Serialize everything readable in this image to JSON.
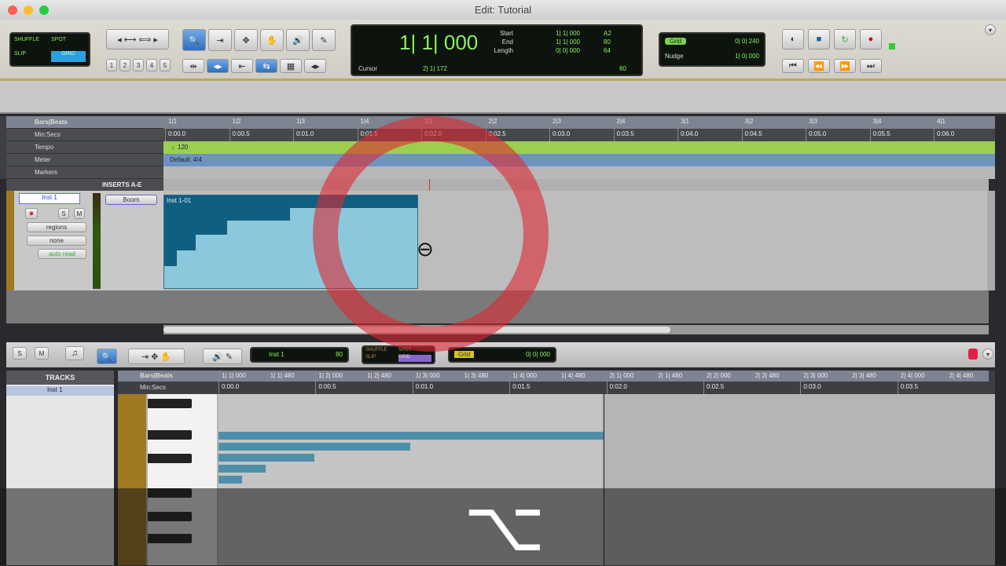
{
  "window": {
    "title": "Edit: Tutorial"
  },
  "toolbar": {
    "edit_modes": [
      "SHUFFLE",
      "SPOT",
      "SLIP",
      "GRID"
    ],
    "zoom_presets": [
      "1",
      "2",
      "3",
      "4",
      "5"
    ],
    "main_counter": "1| 1| 000",
    "start_label": "Start",
    "end_label": "End",
    "length_label": "Length",
    "start": "1| 1| 000",
    "end": "1| 1| 000",
    "length": "0| 0| 000",
    "cursor_label": "Cursor",
    "cursor": "2| 1| 172",
    "meter": "A2",
    "tempo_val": "80",
    "note_val": "64",
    "tempo": "80",
    "grid_label": "Grid",
    "grid_value": "0| 0| 240",
    "nudge_label": "Nudge",
    "nudge_value": "1| 0| 000"
  },
  "rulers": {
    "labels": [
      "Bars|Beats",
      "Min:Secs",
      "Tempo",
      "Meter",
      "Markers"
    ],
    "bars": [
      "1|1",
      "1|2",
      "1|3",
      "1|4",
      "2|1",
      "2|2",
      "2|3",
      "2|4",
      "3|1",
      "3|2",
      "3|3",
      "3|4",
      "4|1"
    ],
    "secs": [
      "0:00.0",
      "0:00.5",
      "0:01.0",
      "0:01.5",
      "0:02.0",
      "0:02.5",
      "0:03.0",
      "0:03.5",
      "0:04.0",
      "0:04.5",
      "0:05.0",
      "0:05.5",
      "0:06.0"
    ],
    "tempo": "120",
    "meter": "Default: 4/4"
  },
  "track": {
    "name": "Inst 1",
    "inserts_header": "INSERTS A-E",
    "insert1": "Boom",
    "view": "regions",
    "group": "none",
    "automation": "auto read",
    "clip": "Inst 1-01",
    "solo": "S",
    "mute": "M"
  },
  "midi_editor": {
    "solo": "S",
    "mute": "M",
    "track_select": "Inst 1",
    "velocity": "80",
    "edit_modes": [
      "SHUFFLE",
      "SPOT",
      "SLIP",
      "GRID"
    ],
    "grid_label": "Grid",
    "grid_value": "0| 0| 000",
    "tracks_header": "TRACKS",
    "track_item": "Inst 1",
    "ruler_labels": [
      "Bars|Beats",
      "Min:Secs"
    ],
    "bars": [
      "1| 1| 000",
      "1| 1| 480",
      "1| 2| 000",
      "1| 2| 480",
      "1| 3| 000",
      "1| 3| 480",
      "1| 4| 000",
      "1| 4| 480",
      "2| 1| 000",
      "2| 1| 480",
      "2| 2| 000",
      "2| 2| 480",
      "2| 3| 000",
      "2| 3| 480",
      "2| 4| 000",
      "2| 4| 480"
    ],
    "secs": [
      "0:00.0",
      "0:00.5",
      "0:01.0",
      "0:01.5",
      "0:02.0",
      "0:02.5",
      "0:03.0",
      "0:03.5"
    ]
  },
  "overlay": {
    "key_symbol": "⌥"
  }
}
